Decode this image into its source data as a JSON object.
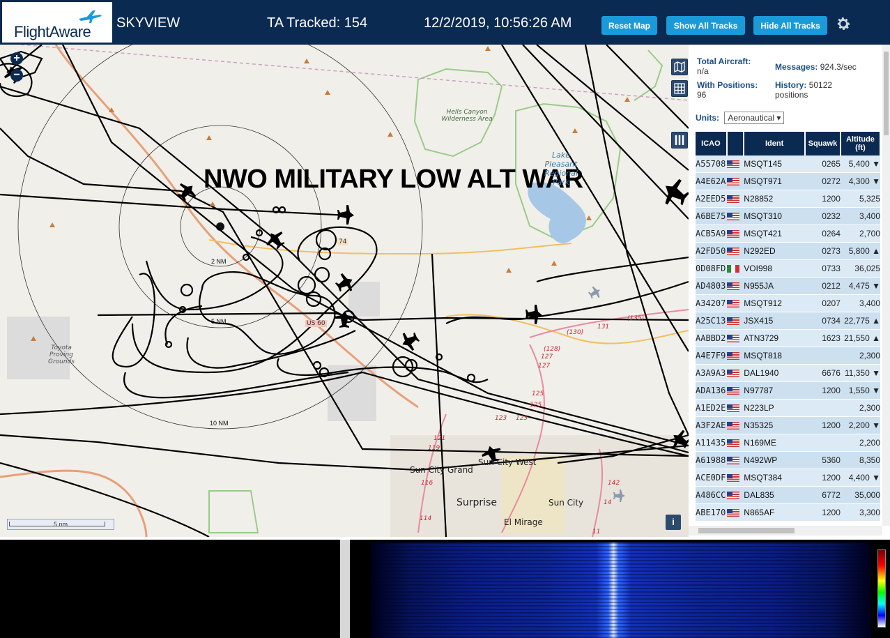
{
  "header": {
    "logo": "FlightAware",
    "product": "SKYVIEW",
    "tracked": "TA Tracked: 154",
    "datetime": "12/2/2019, 10:56:26 AM",
    "reset_map": "Reset Map",
    "show_all_tracks": "Show All Tracks",
    "hide_all_tracks": "Hide All Tracks"
  },
  "map": {
    "overlay_title": "NWO MILITARY LOW ALT WAR",
    "zoom_in": "+",
    "zoom_out": "−",
    "scale": "5 nm",
    "info": "i",
    "rings": [
      "2 NM",
      "5 NM",
      "10 NM"
    ],
    "labels": {
      "hells_canyon": "Hells Canyon Wilderness Area",
      "lake_pleasant": "Lake Pleasant Regional Park",
      "toyota": "Toyota Proving Grounds",
      "sun_city_west": "Sun City West",
      "sun_city_grand": "Sun City Grand",
      "surprise": "Surprise",
      "sun_city": "Sun City",
      "el_mirage": "El Mirage",
      "r74": "74",
      "r60": "US 60"
    },
    "road_numbers": [
      "(128)",
      "127",
      "127",
      "125",
      "125",
      "123",
      "123",
      "121",
      "119",
      "116",
      "114",
      "142",
      "14",
      "11",
      "(130)",
      "131",
      "(135)"
    ]
  },
  "stats": {
    "total_aircraft_label": "Total Aircraft:",
    "total_aircraft_value": "n/a",
    "with_positions_label": "With Positions:",
    "with_positions_value": "96",
    "messages_label": "Messages:",
    "messages_value": "924.3/sec",
    "history_label": "History:",
    "history_value": "50122 positions",
    "units_label": "Units:",
    "units_value": "Aeronautical"
  },
  "table": {
    "headers": [
      "ICAO",
      "",
      "Ident",
      "Squawk",
      "Altitude (ft)"
    ],
    "rows": [
      {
        "icao": "A55708",
        "flag": "us",
        "ident": "MSQT145",
        "squawk": "0265",
        "alt": "5,400 ▼"
      },
      {
        "icao": "A4E62A",
        "flag": "us",
        "ident": "MSQT971",
        "squawk": "0272",
        "alt": "4,300 ▼"
      },
      {
        "icao": "A2EED5",
        "flag": "us",
        "ident": "N28852",
        "squawk": "1200",
        "alt": "5,325"
      },
      {
        "icao": "A6BE75",
        "flag": "us",
        "ident": "MSQT310",
        "squawk": "0232",
        "alt": "3,400"
      },
      {
        "icao": "ACB5A9",
        "flag": "us",
        "ident": "MSQT421",
        "squawk": "0264",
        "alt": "2,700"
      },
      {
        "icao": "A2FD50",
        "flag": "us",
        "ident": "N292ED",
        "squawk": "0273",
        "alt": "5,800 ▲"
      },
      {
        "icao": "0D08FD",
        "flag": "mx",
        "ident": "VOI998",
        "squawk": "0733",
        "alt": "36,025"
      },
      {
        "icao": "AD4803",
        "flag": "us",
        "ident": "N955JA",
        "squawk": "0212",
        "alt": "4,475 ▼"
      },
      {
        "icao": "A34207",
        "flag": "us",
        "ident": "MSQT912",
        "squawk": "0207",
        "alt": "3,400"
      },
      {
        "icao": "A25C13",
        "flag": "us",
        "ident": "JSX415",
        "squawk": "0734",
        "alt": "22,775 ▲"
      },
      {
        "icao": "AABBD2",
        "flag": "us",
        "ident": "ATN3729",
        "squawk": "1623",
        "alt": "21,550 ▲"
      },
      {
        "icao": "A4E7F9",
        "flag": "us",
        "ident": "MSQT818",
        "squawk": "",
        "alt": "2,300"
      },
      {
        "icao": "A3A9A3",
        "flag": "us",
        "ident": "DAL1940",
        "squawk": "6676",
        "alt": "11,350 ▼"
      },
      {
        "icao": "ADA136",
        "flag": "us",
        "ident": "N97787",
        "squawk": "1200",
        "alt": "1,550 ▼"
      },
      {
        "icao": "A1ED2E",
        "flag": "us",
        "ident": "N223LP",
        "squawk": "",
        "alt": "2,300"
      },
      {
        "icao": "A3F2AE",
        "flag": "us",
        "ident": "N35325",
        "squawk": "1200",
        "alt": "2,200 ▼"
      },
      {
        "icao": "A11435",
        "flag": "us",
        "ident": "N169ME",
        "squawk": "",
        "alt": "2,200"
      },
      {
        "icao": "A61988",
        "flag": "us",
        "ident": "N492WP",
        "squawk": "5360",
        "alt": "8,350"
      },
      {
        "icao": "ACE0DF",
        "flag": "us",
        "ident": "MSQT384",
        "squawk": "1200",
        "alt": "4,400 ▼"
      },
      {
        "icao": "A486CC",
        "flag": "us",
        "ident": "DAL835",
        "squawk": "6772",
        "alt": "35,000"
      },
      {
        "icao": "ABE170",
        "flag": "us",
        "ident": "N865AF",
        "squawk": "1200",
        "alt": "3,300"
      }
    ]
  }
}
